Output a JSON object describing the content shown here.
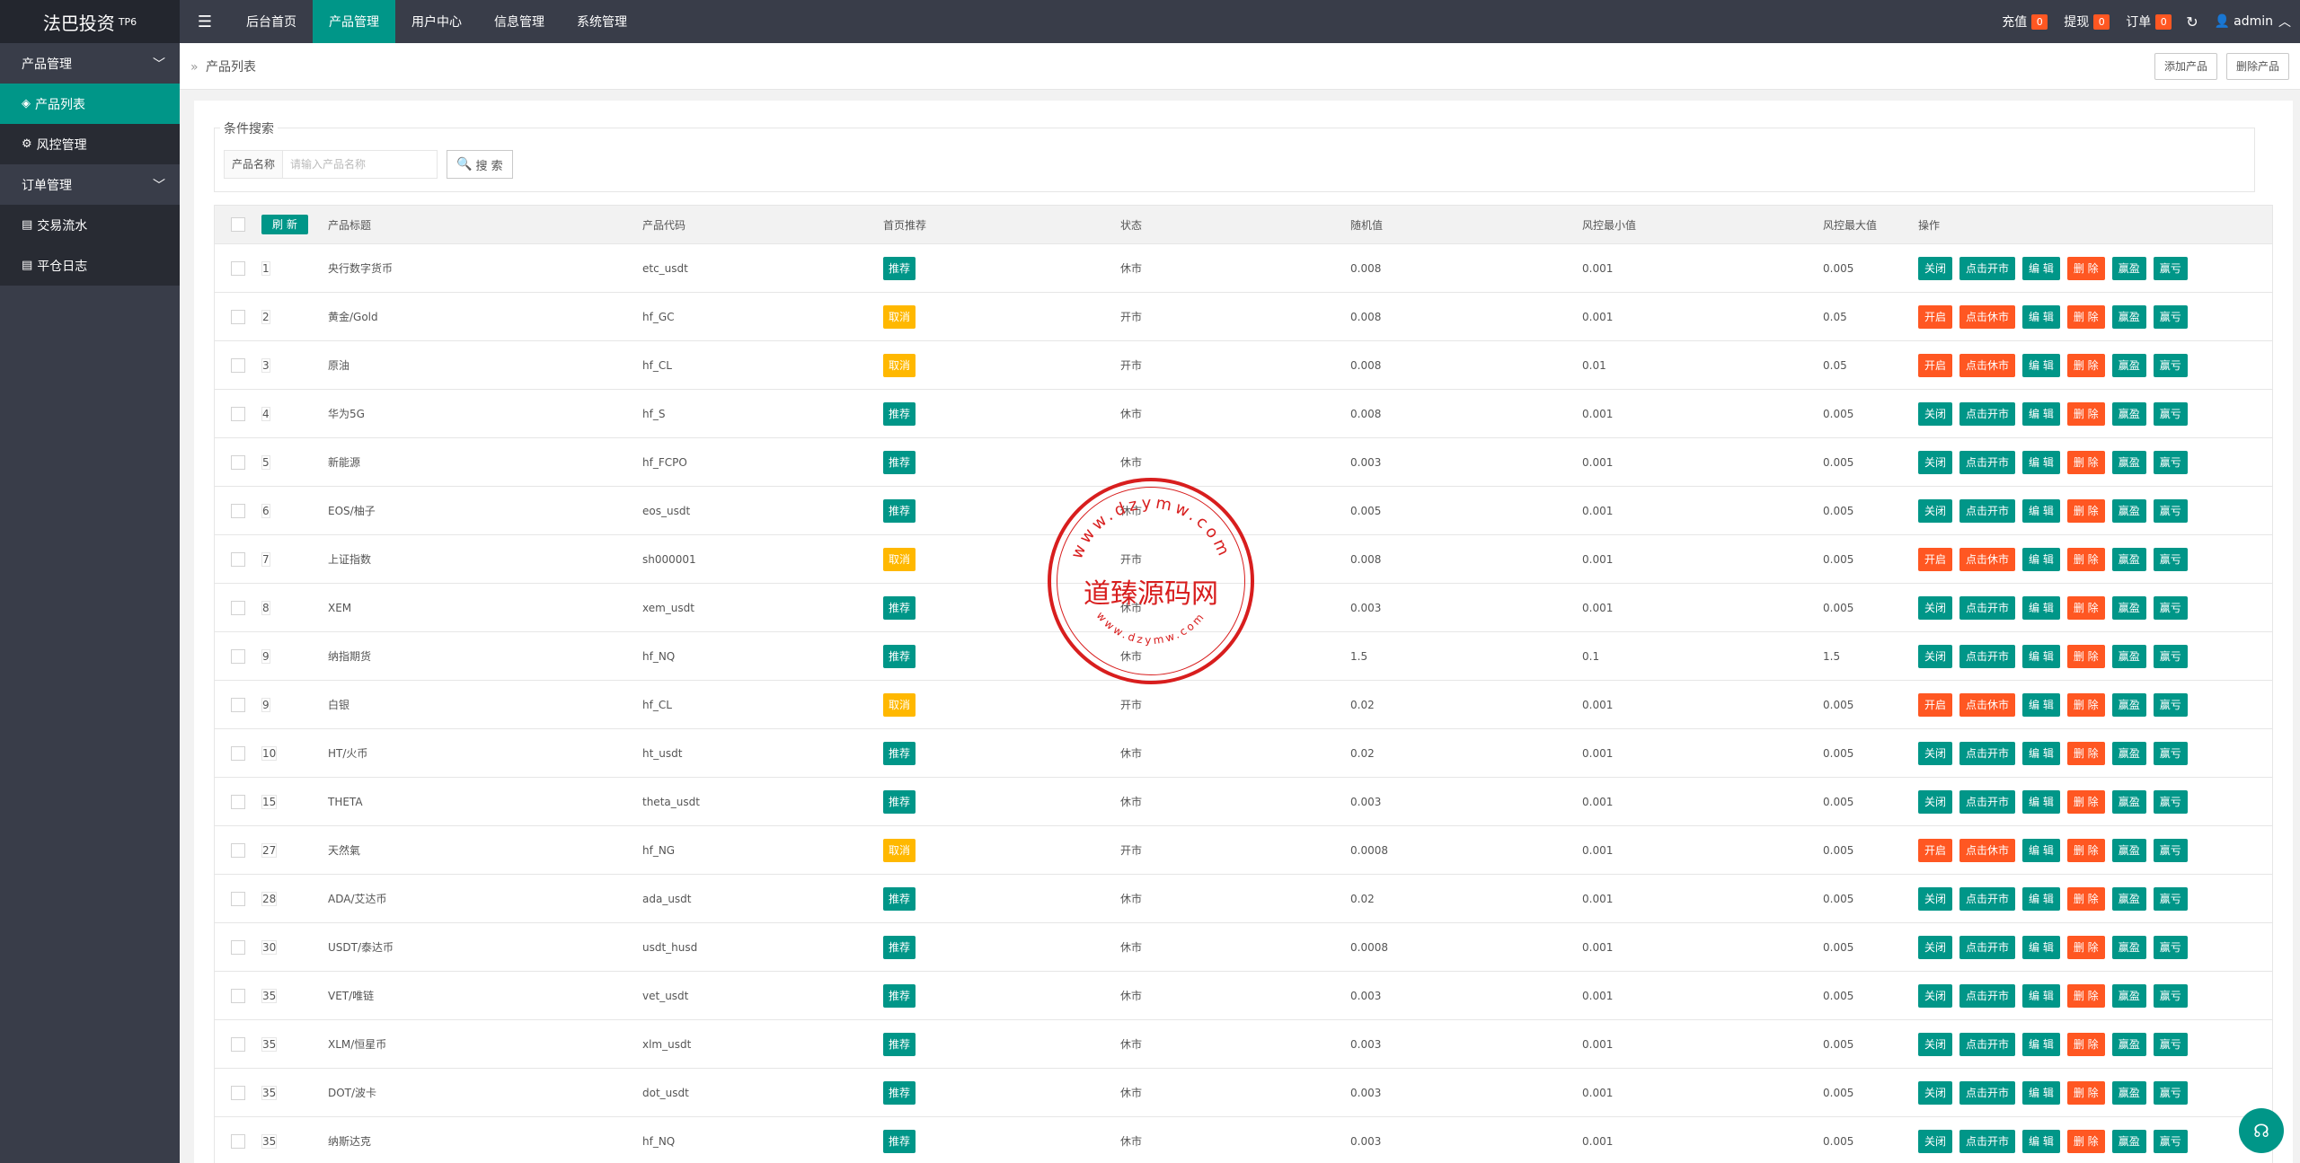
{
  "app": {
    "title": "法巴投资",
    "version": "TP6"
  },
  "topnav": {
    "items": [
      {
        "label": "后台首页",
        "active": false
      },
      {
        "label": "产品管理",
        "active": true
      },
      {
        "label": "用户中心",
        "active": false
      },
      {
        "label": "信息管理",
        "active": false
      },
      {
        "label": "系统管理",
        "active": false
      }
    ],
    "recharge_label": "充值",
    "recharge_count": "0",
    "withdraw_label": "提现",
    "withdraw_count": "0",
    "order_label": "订单",
    "order_count": "0",
    "user": "admin"
  },
  "sidebar": {
    "group1": "产品管理",
    "product_list": "产品列表",
    "risk_control": "风控管理",
    "group2": "订单管理",
    "trade_flow": "交易流水",
    "close_log": "平仓日志"
  },
  "breadcrumb": {
    "text": "产品列表"
  },
  "toolbar": {
    "add_label": "添加产品",
    "delete_label": "删除产品"
  },
  "search": {
    "legend": "条件搜索",
    "field_label": "产品名称",
    "placeholder": "请输入产品名称",
    "button_label": "搜 索"
  },
  "table": {
    "headers": {
      "refresh": "刷 新",
      "title": "产品标题",
      "code": "产品代码",
      "recommend": "首页推荐",
      "status": "状态",
      "random": "随机值",
      "risk_min": "风控最小值",
      "risk_max": "风控最大值",
      "ops": "操作"
    },
    "rows": [
      {
        "sort": "1",
        "title": "央行数字货币",
        "code": "etc_usdt",
        "rec": "推荐",
        "status": "休市",
        "rand": "0.008",
        "min": "0.001",
        "max": "0.005"
      },
      {
        "sort": "2",
        "title": "黄金/Gold",
        "code": "hf_GC",
        "rec": "取消",
        "status": "开市",
        "rand": "0.008",
        "min": "0.001",
        "max": "0.05"
      },
      {
        "sort": "3",
        "title": "原油",
        "code": "hf_CL",
        "rec": "取消",
        "status": "开市",
        "rand": "0.008",
        "min": "0.01",
        "max": "0.05"
      },
      {
        "sort": "4",
        "title": "华为5G",
        "code": "hf_S",
        "rec": "推荐",
        "status": "休市",
        "rand": "0.008",
        "min": "0.001",
        "max": "0.005"
      },
      {
        "sort": "5",
        "title": "新能源",
        "code": "hf_FCPO",
        "rec": "推荐",
        "status": "休市",
        "rand": "0.003",
        "min": "0.001",
        "max": "0.005"
      },
      {
        "sort": "6",
        "title": "EOS/柚子",
        "code": "eos_usdt",
        "rec": "推荐",
        "status": "休市",
        "rand": "0.005",
        "min": "0.001",
        "max": "0.005"
      },
      {
        "sort": "7",
        "title": "上证指数",
        "code": "sh000001",
        "rec": "取消",
        "status": "开市",
        "rand": "0.008",
        "min": "0.001",
        "max": "0.005"
      },
      {
        "sort": "8",
        "title": "XEM",
        "code": "xem_usdt",
        "rec": "推荐",
        "status": "休市",
        "rand": "0.003",
        "min": "0.001",
        "max": "0.005"
      },
      {
        "sort": "9",
        "title": "纳指期货",
        "code": "hf_NQ",
        "rec": "推荐",
        "status": "休市",
        "rand": "1.5",
        "min": "0.1",
        "max": "1.5"
      },
      {
        "sort": "9",
        "title": "白银",
        "code": "hf_CL",
        "rec": "取消",
        "status": "开市",
        "rand": "0.02",
        "min": "0.001",
        "max": "0.005"
      },
      {
        "sort": "10",
        "title": "HT/火币",
        "code": "ht_usdt",
        "rec": "推荐",
        "status": "休市",
        "rand": "0.02",
        "min": "0.001",
        "max": "0.005"
      },
      {
        "sort": "15",
        "title": "THETA",
        "code": "theta_usdt",
        "rec": "推荐",
        "status": "休市",
        "rand": "0.003",
        "min": "0.001",
        "max": "0.005"
      },
      {
        "sort": "27",
        "title": "天然氣",
        "code": "hf_NG",
        "rec": "取消",
        "status": "开市",
        "rand": "0.0008",
        "min": "0.001",
        "max": "0.005"
      },
      {
        "sort": "28",
        "title": "ADA/艾达币",
        "code": "ada_usdt",
        "rec": "推荐",
        "status": "休市",
        "rand": "0.02",
        "min": "0.001",
        "max": "0.005"
      },
      {
        "sort": "30",
        "title": "USDT/泰达币",
        "code": "usdt_husd",
        "rec": "推荐",
        "status": "休市",
        "rand": "0.0008",
        "min": "0.001",
        "max": "0.005"
      },
      {
        "sort": "35",
        "title": "VET/唯链",
        "code": "vet_usdt",
        "rec": "推荐",
        "status": "休市",
        "rand": "0.003",
        "min": "0.001",
        "max": "0.005"
      },
      {
        "sort": "35",
        "title": "XLM/恒星币",
        "code": "xlm_usdt",
        "rec": "推荐",
        "status": "休市",
        "rand": "0.003",
        "min": "0.001",
        "max": "0.005"
      },
      {
        "sort": "35",
        "title": "DOT/波卡",
        "code": "dot_usdt",
        "rec": "推荐",
        "status": "休市",
        "rand": "0.003",
        "min": "0.001",
        "max": "0.005"
      },
      {
        "sort": "35",
        "title": "纳斯达克",
        "code": "hf_NQ",
        "rec": "推荐",
        "status": "休市",
        "rand": "0.003",
        "min": "0.001",
        "max": "0.005"
      }
    ],
    "ops_closed": [
      "关闭",
      "点击开市",
      "编 辑",
      "删 除",
      "赢盈",
      "赢亏"
    ],
    "ops_open": [
      "开启",
      "点击休市",
      "编 辑",
      "删 除",
      "赢盈",
      "赢亏"
    ]
  },
  "stamp": {
    "text": "道臻源码网",
    "arc_text": "www.dzymw.com"
  },
  "colors": {
    "primary": "#009688",
    "warning": "#ffb800",
    "danger": "#ff5722",
    "header": "#393d49"
  }
}
